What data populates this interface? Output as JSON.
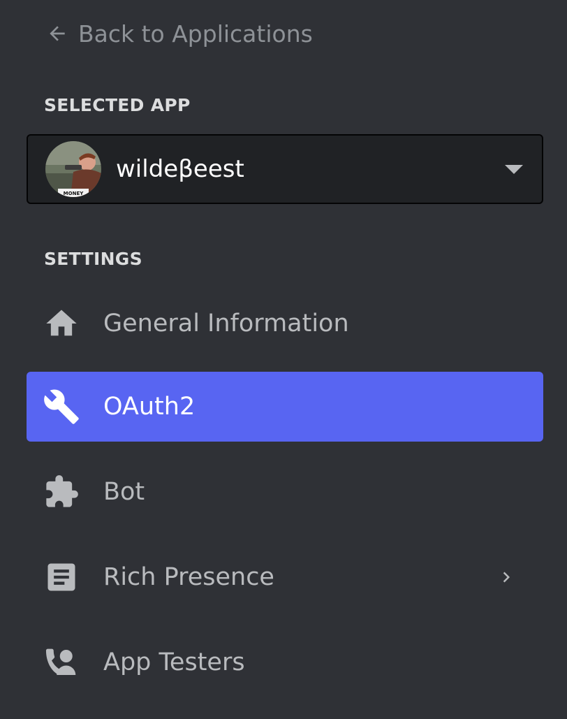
{
  "back": {
    "label": "Back to Applications",
    "icon": "arrow-left-icon"
  },
  "selected_app": {
    "header": "SELECTED APP",
    "name": "wildeβeest",
    "avatar_caption": "MONEY"
  },
  "settings": {
    "header": "SETTINGS",
    "items": [
      {
        "label": "General Information",
        "icon": "home-icon",
        "active": false
      },
      {
        "label": "OAuth2",
        "icon": "wrench-icon",
        "active": true
      },
      {
        "label": "Bot",
        "icon": "puzzle-icon",
        "active": false
      },
      {
        "label": "Rich Presence",
        "icon": "document-icon",
        "active": false,
        "has_submenu": true
      },
      {
        "label": "App Testers",
        "icon": "person-phone-icon",
        "active": false
      }
    ]
  },
  "colors": {
    "background": "#2f3136",
    "select_background": "#202225",
    "active_item": "#5865f2",
    "muted_text": "#8e9297",
    "item_text": "#b9bbbe",
    "header_text": "#dcddde"
  }
}
